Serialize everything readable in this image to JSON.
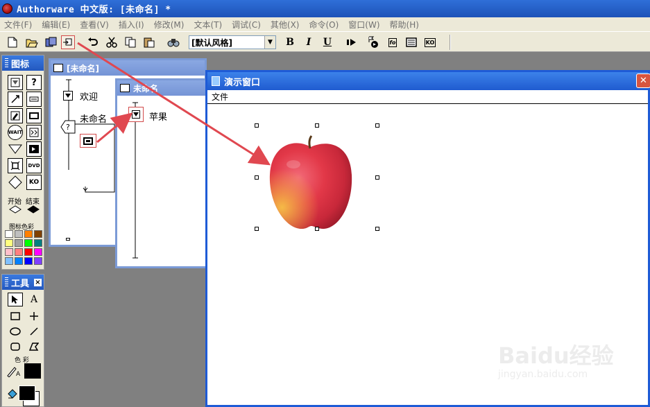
{
  "window": {
    "title": "Authorware 中文版: [未命名] *"
  },
  "menu": [
    "文件(F)",
    "编辑(E)",
    "查看(V)",
    "插入(I)",
    "修改(M)",
    "文本(T)",
    "调试(C)",
    "其他(X)",
    "命令(O)",
    "窗口(W)",
    "帮助(H)"
  ],
  "toolbar": {
    "style_value": "[默认风格]",
    "bold": "B",
    "italic": "I",
    "underline": "U",
    "fo_label": "fo",
    "ko_label": "KO"
  },
  "icon_palette": {
    "title": "图标",
    "wait_label": "WAIT",
    "dvd_label": "DVD",
    "ko_label": "KO",
    "start_label": "开始",
    "end_label": "结束",
    "color_title": "图标色彩",
    "swatches": [
      "#ffffff",
      "#c0c0c0",
      "#ff8000",
      "#804000",
      "#ffff80",
      "#a0a0a0",
      "#00ff00",
      "#008080",
      "#ffc0cb",
      "#ff8080",
      "#ff0000",
      "#ff00ff",
      "#80c0ff",
      "#0080ff",
      "#0000ff",
      "#8040ff"
    ]
  },
  "tools_palette": {
    "title": "工具",
    "color_label": "色 彩",
    "text_tool": "A"
  },
  "flow_main": {
    "title": "[未命名]",
    "icon1": "欢迎",
    "icon2": "未命名"
  },
  "flow_sub": {
    "title": "未命名",
    "icon1": "苹果"
  },
  "presentation": {
    "title": "演示窗口",
    "menu": "文件"
  },
  "watermark": {
    "brand": "Baidu经验",
    "url": "jingyan.baidu.com"
  },
  "colors": {
    "titlebar": "#1d52b8",
    "arrow": "#e04850",
    "present_border": "#1e5bd6"
  }
}
